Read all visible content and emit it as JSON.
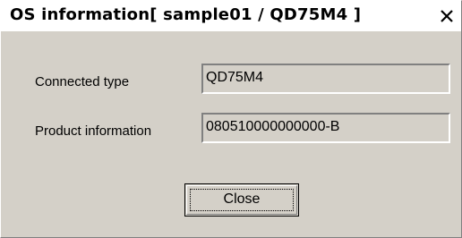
{
  "window": {
    "title": "OS information[ sample01 / QD75M4 ]"
  },
  "fields": {
    "connected_type_label": "Connected type",
    "connected_type_value": "QD75M4",
    "product_info_label": "Product information",
    "product_info_value": "080510000000000-B"
  },
  "buttons": {
    "close_label": "Close"
  },
  "icons": {
    "close": "close-icon"
  },
  "colors": {
    "dialog_face": "#d4d0c8",
    "titlebar": "#ffffff"
  }
}
